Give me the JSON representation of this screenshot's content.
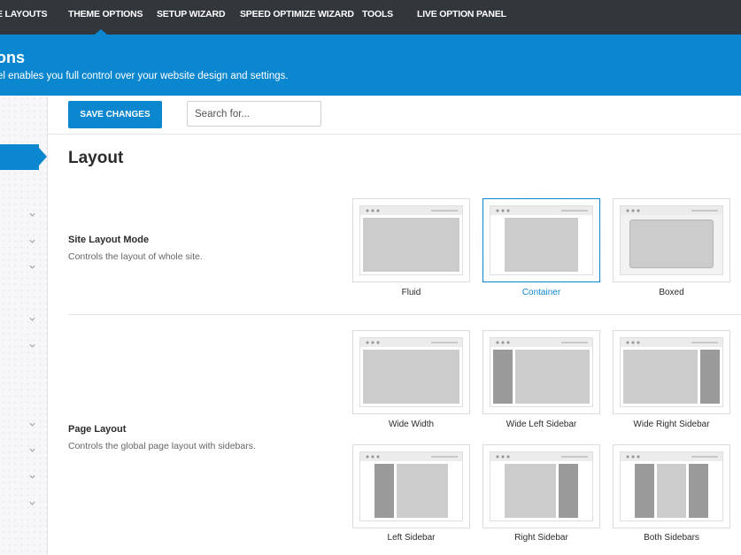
{
  "nav": {
    "items": [
      {
        "label": "E LAYOUTS"
      },
      {
        "label": "THEME OPTIONS"
      },
      {
        "label": "SETUP WIZARD"
      },
      {
        "label": "SPEED OPTIMIZE WIZARD"
      },
      {
        "label": "TOOLS"
      },
      {
        "label": "LIVE OPTION PANEL"
      }
    ],
    "active_index": 1
  },
  "banner": {
    "title": "ons",
    "subtitle": "el enables you full control over your website design and settings."
  },
  "toolbar": {
    "save_label": "SAVE CHANGES",
    "search_placeholder": "Search for..."
  },
  "section": {
    "title": "Layout"
  },
  "site_layout": {
    "label": "Site Layout Mode",
    "description": "Controls the layout of whole site.",
    "options": [
      {
        "label": "Fluid"
      },
      {
        "label": "Container"
      },
      {
        "label": "Boxed"
      }
    ],
    "selected": "Container"
  },
  "page_layout": {
    "label": "Page Layout",
    "description": "Controls the global page layout with sidebars.",
    "options": [
      {
        "label": "Wide Width"
      },
      {
        "label": "Wide Left Sidebar"
      },
      {
        "label": "Wide Right Sidebar"
      },
      {
        "label": "Left Sidebar"
      },
      {
        "label": "Right Sidebar"
      },
      {
        "label": "Both Sidebars"
      }
    ]
  },
  "colors": {
    "accent": "#0b87d0",
    "nav_bg": "#32373c"
  }
}
